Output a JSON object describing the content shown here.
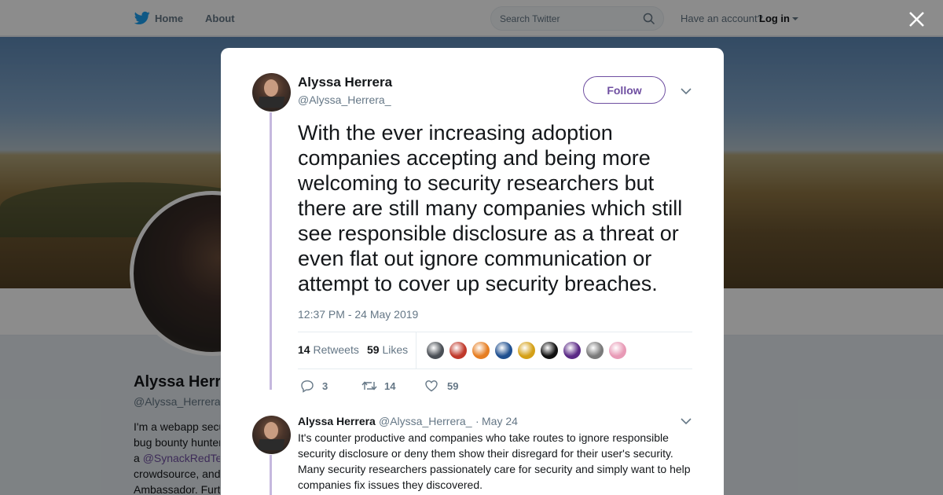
{
  "nav": {
    "home_label": "Home",
    "about_label": "About",
    "search_placeholder": "Search Twitter",
    "have_account": "Have an account?",
    "login_label": "Log in"
  },
  "profile": {
    "name": "Alyssa Herrera",
    "handle": "@Alyssa_Herrera_",
    "bio_lines": [
      "I'm a webapp security researcher",
      "bug bounty hunter, and",
      "a",
      "crowdsource, and",
      "Ambassador. Furt"
    ],
    "bio_link": "@SynackRedTe"
  },
  "tweet": {
    "author_name": "Alyssa Herrera",
    "author_handle": "@Alyssa_Herrera_",
    "follow_label": "Follow",
    "text": "With the ever increasing adoption companies accepting and being more welcoming to security researchers but there are still many companies which still see responsible disclosure as a threat or even flat out ignore communication or attempt to cover up security breaches.",
    "timestamp": "12:37 PM - 24 May 2019",
    "retweets_count": "14",
    "retweets_label": "Retweets",
    "likes_count": "59",
    "likes_label": "Likes",
    "likers": [
      "#4a4f55",
      "#c0392b",
      "#e67e22",
      "#1f4f8f",
      "#d4a017",
      "#111111",
      "#5b2a86",
      "#7a7a7a",
      "#e89ab6"
    ],
    "actions": {
      "replies": "3",
      "retweets": "14",
      "likes": "59"
    }
  },
  "reply": {
    "author_name": "Alyssa Herrera",
    "author_handle": "@Alyssa_Herrera_",
    "separator": "·",
    "date": "May 24",
    "text": "It's counter productive and companies who take routes to ignore responsible security disclosure or deny them show their disregard for their user's security. Many security researchers passionately care for security and simply want to help companies fix issues they discovered."
  },
  "colors": {
    "accent": "#6f4fa1",
    "thread_line": "#c5b8de",
    "twitter_blue": "#1da1f2"
  }
}
